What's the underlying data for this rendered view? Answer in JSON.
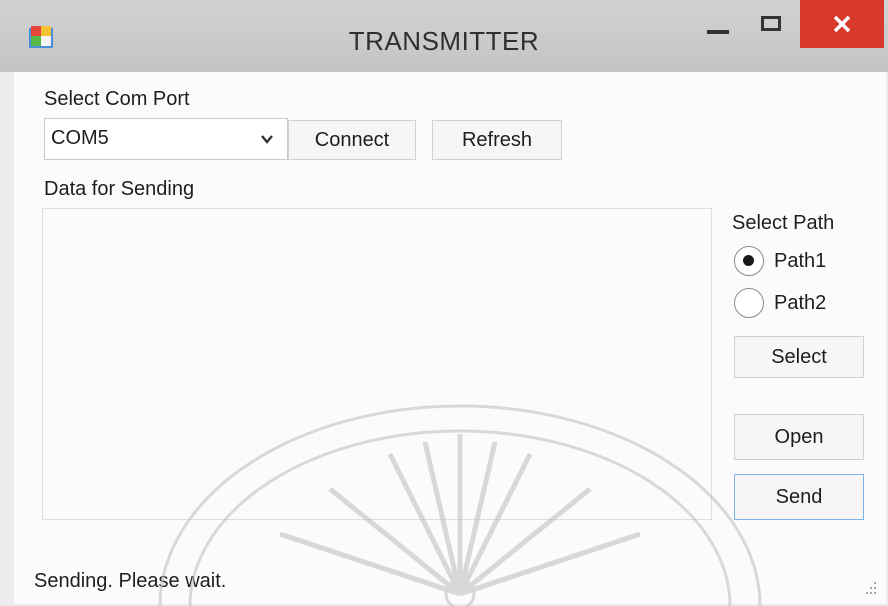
{
  "window": {
    "title": "TRANSMITTER"
  },
  "com_port": {
    "label": "Select Com Port",
    "selected": "COM5"
  },
  "buttons": {
    "connect": "Connect",
    "refresh": "Refresh",
    "select": "Select",
    "open": "Open",
    "send": "Send"
  },
  "data_section": {
    "label": "Data for Sending",
    "value": ""
  },
  "path": {
    "label": "Select Path",
    "options": [
      {
        "label": "Path1",
        "checked": true
      },
      {
        "label": "Path2",
        "checked": false
      }
    ]
  },
  "status": "Sending. Please wait.",
  "colors": {
    "close_button": "#d9392b",
    "title_bar": "#c9c9c9",
    "client_bg": "#fbfbfb"
  },
  "icons": [
    "app-icon",
    "minimize-icon",
    "maximize-icon",
    "close-icon",
    "chevron-down-icon",
    "scroll-up-icon",
    "scroll-down-icon",
    "resize-grip-icon"
  ]
}
